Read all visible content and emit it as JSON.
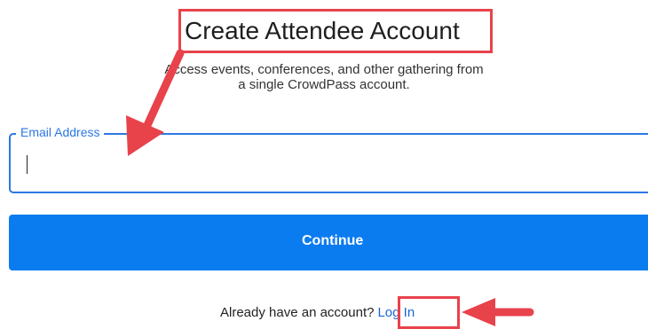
{
  "header": {
    "title": "Create Attendee Account",
    "subtitle": "Access events, conferences, and other gathering from a single CrowdPass account."
  },
  "form": {
    "email_label": "Email Address",
    "email_value": "",
    "continue_label": "Continue"
  },
  "footer": {
    "prompt": "Already have an account?",
    "login_label": "Log In"
  },
  "colors": {
    "accent": "#2b78e4",
    "button": "#0b7bf0",
    "annotation": "#e8424b"
  }
}
